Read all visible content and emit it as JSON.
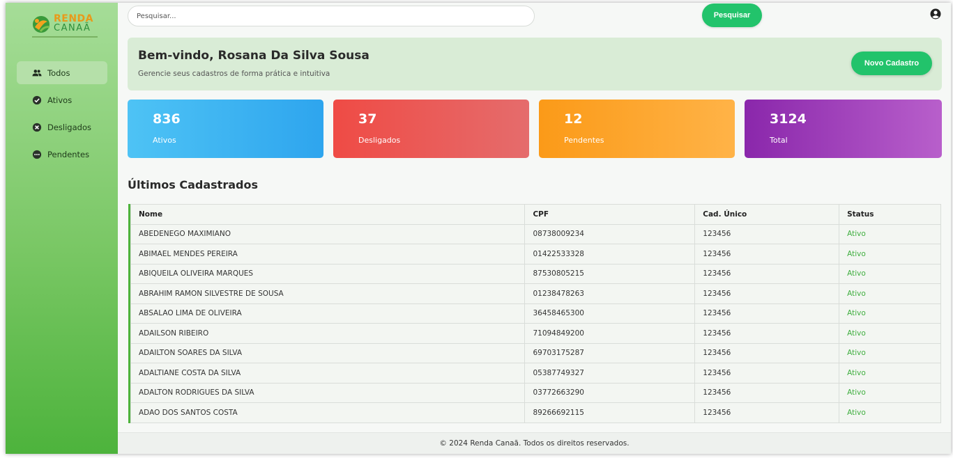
{
  "brand": {
    "line1": "RENDA",
    "line2": "CANAÃ"
  },
  "sidebar": {
    "items": [
      {
        "label": "Todos",
        "icon": "users-icon"
      },
      {
        "label": "Ativos",
        "icon": "check-circle-icon"
      },
      {
        "label": "Desligados",
        "icon": "x-circle-icon"
      },
      {
        "label": "Pendentes",
        "icon": "dots-circle-icon"
      }
    ]
  },
  "topbar": {
    "search_placeholder": "Pesquisar...",
    "search_button": "Pesquisar",
    "user_icon": "user-circle-icon"
  },
  "welcome": {
    "title": "Bem-vindo, Rosana Da Silva Sousa",
    "subtitle": "Gerencie seus cadastros de forma prática e intuitiva",
    "new_button": "Novo Cadastro"
  },
  "stats": [
    {
      "value": "836",
      "label": "Ativos",
      "color": "#2ea5ee"
    },
    {
      "value": "37",
      "label": "Desligados",
      "color": "#ef4b45"
    },
    {
      "value": "12",
      "label": "Pendentes",
      "color": "#fb9a18"
    },
    {
      "value": "3124",
      "label": "Total",
      "color": "#8a27ab"
    }
  ],
  "table": {
    "title": "Últimos Cadastrados",
    "headers": [
      "Nome",
      "CPF",
      "Cad. Único",
      "Status"
    ],
    "rows": [
      [
        "ABEDENEGO MAXIMIANO",
        "08738009234",
        "123456",
        "Ativo"
      ],
      [
        "ABIMAEL MENDES PEREIRA",
        "01422533328",
        "123456",
        "Ativo"
      ],
      [
        "ABIQUEILA OLIVEIRA MARQUES",
        "87530805215",
        "123456",
        "Ativo"
      ],
      [
        "ABRAHIM RAMON SILVESTRE DE SOUSA",
        "01238478263",
        "123456",
        "Ativo"
      ],
      [
        "ABSALAO LIMA DE OLIVEIRA",
        "36458465300",
        "123456",
        "Ativo"
      ],
      [
        "ADAILSON RIBEIRO",
        "71094849200",
        "123456",
        "Ativo"
      ],
      [
        "ADAILTON SOARES DA SILVA",
        "69703175287",
        "123456",
        "Ativo"
      ],
      [
        "ADALTIANE COSTA DA SILVA",
        "05387749327",
        "123456",
        "Ativo"
      ],
      [
        "ADALTON RODRIGUES DA SILVA",
        "03772663290",
        "123456",
        "Ativo"
      ],
      [
        "ADAO DOS SANTOS COSTA",
        "89266692115",
        "123456",
        "Ativo"
      ]
    ]
  },
  "footer": {
    "text": "© 2024 Renda Canaã. Todos os direitos reservados."
  },
  "colors": {
    "accent": "#22c36b",
    "sidebar": "#79c764",
    "status_active": "#3fae3f"
  }
}
